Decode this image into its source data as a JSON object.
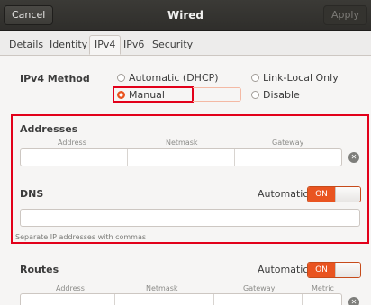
{
  "window": {
    "cancel_label": "Cancel",
    "title": "Wired",
    "apply_label": "Apply"
  },
  "tabs": [
    {
      "label": "Details"
    },
    {
      "label": "Identity"
    },
    {
      "label": "IPv4"
    },
    {
      "label": "IPv6"
    },
    {
      "label": "Security"
    }
  ],
  "active_tab": "IPv4",
  "ipv4_method": {
    "label": "IPv4 Method",
    "options": [
      {
        "label": "Automatic (DHCP)",
        "selected": false
      },
      {
        "label": "Link-Local Only",
        "selected": false
      },
      {
        "label": "Manual",
        "selected": true
      },
      {
        "label": "Disable",
        "selected": false
      }
    ]
  },
  "addresses": {
    "heading": "Addresses",
    "columns": [
      "Address",
      "Netmask",
      "Gateway"
    ]
  },
  "dns": {
    "heading": "DNS",
    "automatic_label": "Automatic",
    "toggle_label": "ON",
    "hint": "Separate IP addresses with commas"
  },
  "routes": {
    "heading": "Routes",
    "automatic_label": "Automatic",
    "toggle_label": "ON",
    "columns": [
      "Address",
      "Netmask",
      "Gateway",
      "Metric"
    ]
  },
  "colors": {
    "accent": "#E95420",
    "highlight_box": "#E2001A",
    "titlebar": "#2F2E2B"
  }
}
